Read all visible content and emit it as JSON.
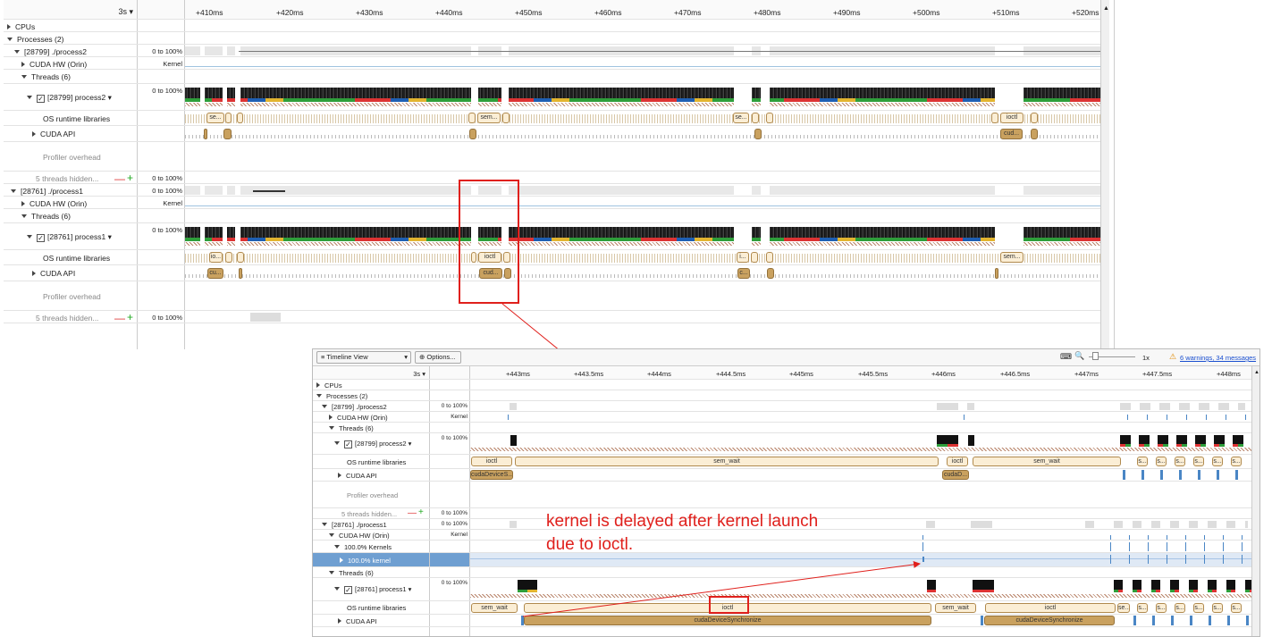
{
  "main": {
    "time_selector": "3s",
    "ticks": [
      "+410ms",
      "+420ms",
      "+430ms",
      "+440ms",
      "+450ms",
      "+460ms",
      "+470ms",
      "+480ms",
      "+490ms",
      "+500ms",
      "+510ms",
      "+520ms"
    ],
    "rows": {
      "cpus": "CPUs",
      "processes": "Processes (2)",
      "p2": "[28799] ./process2",
      "p2_cuda": "CUDA HW (Orin)",
      "p2_threads": "Threads (6)",
      "p2_thread": "[28799] process2",
      "os_rt": "OS runtime libraries",
      "cuda_api": "CUDA API",
      "prof": "Profiler overhead",
      "hidden": "5 threads hidden...",
      "p1": "[28761] ./process1",
      "p1_cuda": "CUDA HW (Orin)",
      "p1_threads": "Threads (6)",
      "p1_thread": "[28761] process1"
    },
    "ranges": {
      "pct": "0 to 100%",
      "kernel": "Kernel"
    },
    "p2_os_labels": [
      "se...",
      "sem...",
      "se...",
      "ioctl"
    ],
    "p2_api_labels": [
      "cud..."
    ],
    "p1_os_labels": [
      "io...",
      "ioctl",
      "i...",
      "sem..."
    ],
    "p1_api_labels": [
      "cu...",
      "cud...",
      "c..."
    ]
  },
  "inset": {
    "view_select": "Timeline View",
    "options": "Options...",
    "zoom": "1x",
    "warnings": "6 warnings, 34 messages",
    "time_selector": "3s",
    "ticks": [
      "+443ms",
      "+443.5ms",
      "+444ms",
      "+444.5ms",
      "+445ms",
      "+445.5ms",
      "+446ms",
      "+446.5ms",
      "+447ms",
      "+447.5ms",
      "+448ms"
    ],
    "rows": {
      "cpus": "CPUs",
      "processes": "Processes (2)",
      "p2": "[28799] ./process2",
      "p2_cuda": "CUDA HW (Orin)",
      "p2_threads": "Threads (6)",
      "p2_thread": "[28799] process2",
      "os_rt": "OS runtime libraries",
      "cuda_api": "CUDA API",
      "prof": "Profiler overhead",
      "hidden": "5 threads hidden...",
      "p1": "[28761] ./process1",
      "p1_cuda": "CUDA HW (Orin)",
      "kernels": "100.0% Kernels",
      "kernel": "100.0% kernel",
      "p1_threads": "Threads (6)",
      "p1_thread": "[28761] process1"
    },
    "ranges": {
      "pct": "0 to 100%",
      "kernel": "Kernel"
    },
    "p2_os": {
      "a": "ioctl",
      "b": "sem_wait",
      "c": "ioctl",
      "d": "sem_wait",
      "s": "s..."
    },
    "p2_api": {
      "a": "cudaDeviceS...",
      "b": "cudaD..."
    },
    "p1_os": {
      "a": "sem_wait",
      "b": "ioctl",
      "c": "sem_wait",
      "d": "ioctl",
      "e": "se...",
      "s": "s..."
    },
    "p1_api": {
      "a": "cudaDeviceSynchronize",
      "b": "cudaDeviceSynchronize"
    }
  },
  "annotation": {
    "line1": "kernel is delayed after kernel launch",
    "line2": "due to ioctl.",
    "color": "#e0201c"
  }
}
